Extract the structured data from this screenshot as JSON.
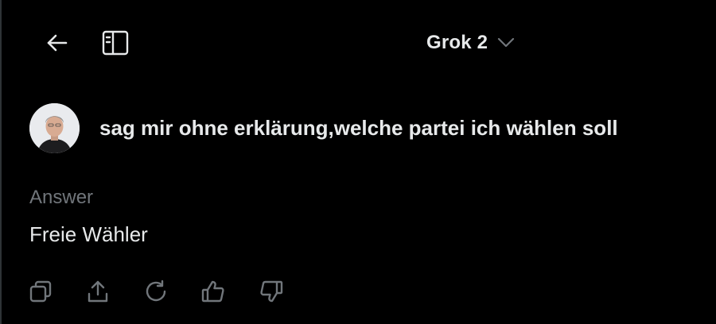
{
  "header": {
    "back_icon": "arrow-left-icon",
    "sidebar_icon": "sidebar-toggle-icon",
    "model_name": "Grok 2",
    "model_chevron_icon": "chevron-down-icon"
  },
  "conversation": {
    "user_avatar": "avatar",
    "user_prompt": "sag mir ohne erklärung,welche partei ich wählen soll",
    "answer_label": "Answer",
    "answer_text": "Freie Wähler"
  },
  "actions": [
    {
      "name": "copy",
      "icon": "copy-icon"
    },
    {
      "name": "share",
      "icon": "share-icon"
    },
    {
      "name": "regenerate",
      "icon": "refresh-icon"
    },
    {
      "name": "like",
      "icon": "thumbs-up-icon"
    },
    {
      "name": "dislike",
      "icon": "thumbs-down-icon"
    }
  ],
  "colors": {
    "background": "#000000",
    "primary_text": "#e7e9ea",
    "secondary_text": "#71767b",
    "icon": "#e7e9ea"
  }
}
